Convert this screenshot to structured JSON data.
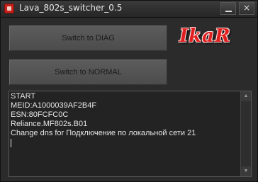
{
  "window": {
    "title": "Lava_802s_switcher_0.5",
    "minimize_glyph": "",
    "close_glyph": "×"
  },
  "buttons": {
    "diag_label": "Switch to DIAG",
    "normal_label": "Switch to NORMAL"
  },
  "logo": {
    "text": "IkaR"
  },
  "log": {
    "lines": [
      "START",
      "MEID:A1000039AF2B4F",
      "ESN:80FCFC0C",
      "Reliance.MF802s.B01",
      "Change dns for Подключение по локальной сети 21"
    ]
  },
  "colors": {
    "background": "#2b2b2b",
    "button": "#555555",
    "logo_red": "#e02020",
    "log_text": "#e6e6e6"
  },
  "icons": {
    "app": "app-icon",
    "minimize": "minimize-icon",
    "close": "close-icon"
  }
}
